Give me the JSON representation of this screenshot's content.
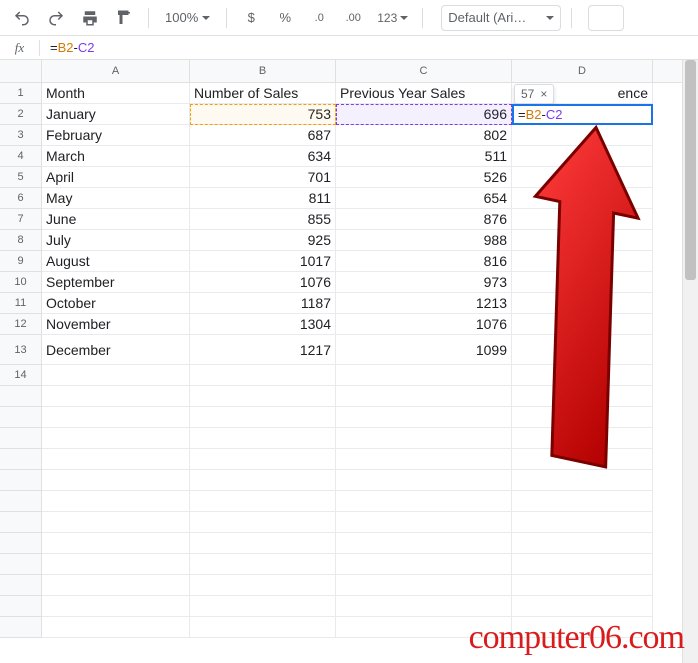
{
  "toolbar": {
    "zoom": "100%",
    "currency_symbol": "$",
    "percent_symbol": "%",
    "dec_decrease": ".0",
    "dec_increase": ".00",
    "format_more": "123",
    "font_name": "Default (Ari…",
    "font_size": ""
  },
  "formula_bar": {
    "fx": "fx",
    "tokens": {
      "eq": "=",
      "b2": "B2",
      "op": "-",
      "c2": "C2"
    }
  },
  "hint": {
    "value": "57",
    "close": "×"
  },
  "active_cell": {
    "tokens": {
      "eq": "=",
      "b2": "B2",
      "op": "-",
      "c2": "C2"
    }
  },
  "columns": [
    "A",
    "B",
    "C",
    "D"
  ],
  "row_numbers": [
    1,
    2,
    3,
    4,
    5,
    6,
    7,
    8,
    9,
    10,
    11,
    12,
    13,
    14
  ],
  "headers": {
    "a": "Month",
    "b": "Number of Sales",
    "c": "Previous Year Sales",
    "d": "ence"
  },
  "rows": [
    {
      "a": "January",
      "b": "753",
      "c": "696"
    },
    {
      "a": "February",
      "b": "687",
      "c": "802"
    },
    {
      "a": "March",
      "b": "634",
      "c": "511"
    },
    {
      "a": "April",
      "b": "701",
      "c": "526"
    },
    {
      "a": "May",
      "b": "811",
      "c": "654"
    },
    {
      "a": "June",
      "b": "855",
      "c": "876"
    },
    {
      "a": "July",
      "b": "925",
      "c": "988"
    },
    {
      "a": "August",
      "b": "1017",
      "c": "816"
    },
    {
      "a": "September",
      "b": "1076",
      "c": "973"
    },
    {
      "a": "October",
      "b": "1187",
      "c": "1213"
    },
    {
      "a": "November",
      "b": "1304",
      "c": "1076"
    },
    {
      "a": "December",
      "b": "1217",
      "c": "1099"
    }
  ],
  "watermark": "computer06.com"
}
